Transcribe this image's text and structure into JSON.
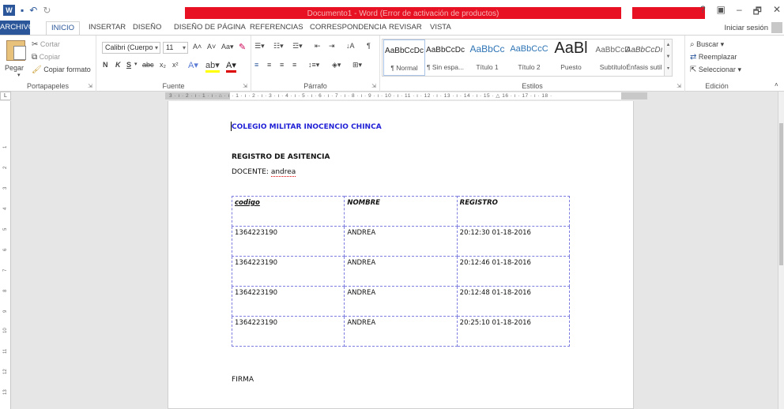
{
  "window": {
    "title": "Documento1 - Word (Error de activación de productos)",
    "controls": [
      "?",
      "▣",
      "–",
      "🗗",
      "✕"
    ]
  },
  "tabs": {
    "file": "ARCHIVO",
    "items": [
      "INICIO",
      "INSERTAR",
      "DISEÑO",
      "DISEÑO DE PÁGINA",
      "REFERENCIAS",
      "CORRESPONDENCIA",
      "REVISAR",
      "VISTA"
    ],
    "active": "INICIO",
    "signin": "Iniciar sesión"
  },
  "ribbon": {
    "clipboard": {
      "label": "Portapapeles",
      "paste": "Pegar",
      "cut": "Cortar",
      "copy": "Copiar",
      "format_painter": "Copiar formato"
    },
    "font": {
      "label": "Fuente",
      "font_name": "Calibri (Cuerpo",
      "font_size": "11",
      "bold": "N",
      "italic": "K",
      "underline": "S",
      "strike": "abc",
      "subscript": "x₂",
      "superscript": "x²"
    },
    "paragraph": {
      "label": "Párrafo"
    },
    "styles": {
      "label": "Estilos",
      "items": [
        {
          "sample": "AaBbCcDc",
          "name": "¶ Normal"
        },
        {
          "sample": "AaBbCcDc",
          "name": "¶ Sin espa..."
        },
        {
          "sample": "AaBbCc",
          "name": "Título 1"
        },
        {
          "sample": "AaBbCcC",
          "name": "Título 2"
        },
        {
          "sample": "AaBl",
          "name": "Puesto"
        },
        {
          "sample": "AaBbCcD",
          "name": "Subtítulo"
        },
        {
          "sample": "AaBbCcDı",
          "name": "Énfasis sutil"
        }
      ]
    },
    "editing": {
      "label": "Edición",
      "find": "Buscar",
      "replace": "Reemplazar",
      "select": "Seleccionar"
    }
  },
  "ruler": {
    "numbers": "3 · ı · 2 · ı · 1 · ı · ⌂ · ı · 1 · ı · 2 · ı · 3 · ı · 4 · ı · 5 · ı · 6 · ı · 7 · ı · 8 · ı · 9 · ı · 10 · ı · 11 · ı · 12 · ı · 13 · ı · 14 · ı · 15 · △ 16 · ı · 17 · ı · 18 ·",
    "vertical": [
      "1",
      "2",
      "3",
      "4",
      "5",
      "6",
      "7",
      "8",
      "9",
      "10",
      "11",
      "12",
      "13"
    ]
  },
  "document": {
    "school": "COLEGIO MILITAR INOCENCIO CHINCA",
    "register_title": "REGISTRO DE ASITENCIA",
    "teacher_label": "DOCENTE:",
    "teacher_name": "andrea",
    "table": {
      "headers": [
        "codigo",
        "NOMBRE",
        "REGISTRO"
      ],
      "rows": [
        [
          "1364223190",
          "ANDREA",
          "20:12:30 01-18-2016"
        ],
        [
          "1364223190",
          "ANDREA",
          "20:12:46 01-18-2016"
        ],
        [
          "1364223190",
          "ANDREA",
          "20:12:48 01-18-2016"
        ],
        [
          "1364223190",
          "ANDREA",
          "20:25:10 01-18-2016"
        ]
      ]
    },
    "signature_label": "FIRMA"
  }
}
